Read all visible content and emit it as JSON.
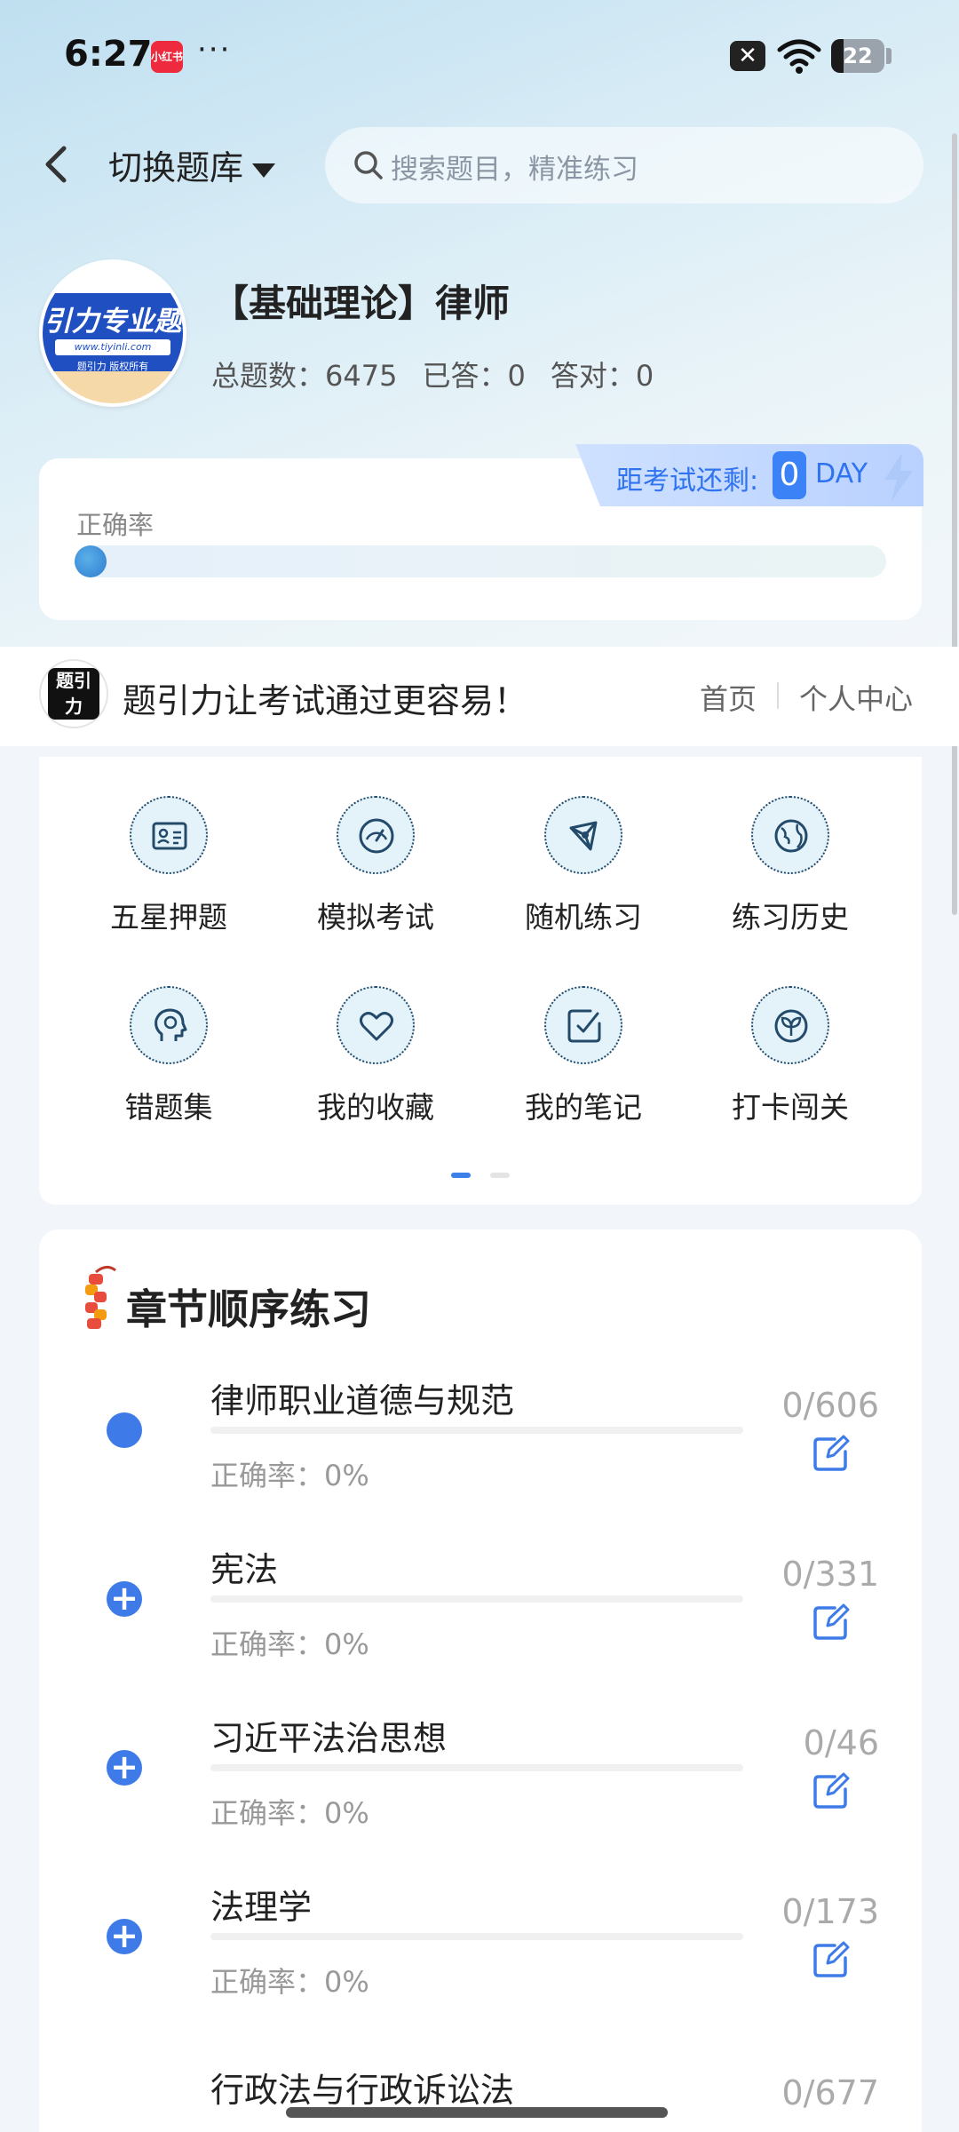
{
  "status_bar": {
    "time": "6:27",
    "app_badge": "小红书",
    "more": "···",
    "battery": "22"
  },
  "nav": {
    "switch_bank": "切换题库",
    "search_placeholder": "搜索题目，精准练习"
  },
  "bank": {
    "logo_main": "引力专业题",
    "logo_url": "www.tiyinli.com",
    "logo_sub": "题引力 版权所有",
    "title": "【基础理论】律师",
    "total_label": "总题数：",
    "total": "6475",
    "answered_label": "已答：",
    "answered": "0",
    "correct_label": "答对：",
    "correct": "0"
  },
  "accuracy": {
    "label": "正确率",
    "value_percent": 0,
    "countdown_label": "距考试还剩:",
    "countdown_days": "0",
    "countdown_unit": "DAY"
  },
  "promo": {
    "logo_text": "题引力",
    "slogan": "题引力让考试通过更容易！",
    "home": "首页",
    "profile": "个人中心"
  },
  "functions": [
    {
      "label": "五星押题",
      "icon": "id-card-icon"
    },
    {
      "label": "模拟考试",
      "icon": "gauge-icon"
    },
    {
      "label": "随机练习",
      "icon": "network-icon"
    },
    {
      "label": "练习历史",
      "icon": "globe-icon"
    },
    {
      "label": "错题集",
      "icon": "head-icon"
    },
    {
      "label": "我的收藏",
      "icon": "heart-icon"
    },
    {
      "label": "我的笔记",
      "icon": "note-check-icon"
    },
    {
      "label": "打卡闯关",
      "icon": "sprout-icon"
    }
  ],
  "chapters": {
    "title": "章节顺序练习",
    "items": [
      {
        "name": "律师职业道德与规范",
        "accuracy": "正确率：0%",
        "count": "0/606",
        "marker": "dot"
      },
      {
        "name": "宪法",
        "accuracy": "正确率：0%",
        "count": "0/331",
        "marker": "plus"
      },
      {
        "name": "习近平法治思想",
        "accuracy": "正确率：0%",
        "count": "0/46",
        "marker": "plus"
      },
      {
        "name": "法理学",
        "accuracy": "正确率：0%",
        "count": "0/173",
        "marker": "plus"
      },
      {
        "name": "行政法与行政诉讼法",
        "accuracy": "",
        "count": "0/677",
        "marker": "plus"
      }
    ]
  },
  "colors": {
    "accent": "#3e7be8",
    "countdown_text": "#2f73f0",
    "icon_bg": "#e4f3f9",
    "icon_stroke": "#234a6b"
  }
}
